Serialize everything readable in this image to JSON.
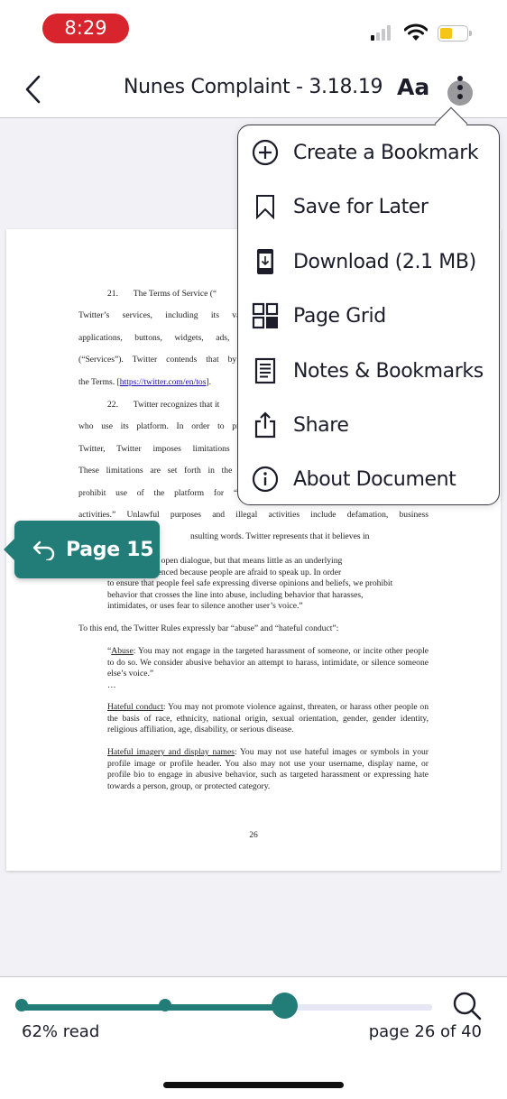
{
  "status_bar": {
    "time": "8:29",
    "signal_bars_active": 1,
    "signal_bars_total": 4,
    "battery_level": 0.45,
    "battery_color": "#f5c518",
    "time_pill_color": "#d7242d"
  },
  "header": {
    "back_icon": "chevron-left-icon",
    "title": "Nunes Complaint - 3.18.19",
    "text_size_label": "Aa",
    "more_icon": "more-vertical-icon"
  },
  "menu": {
    "items": [
      {
        "icon": "plus-circle-icon",
        "label": "Create a Bookmark"
      },
      {
        "icon": "bookmark-icon",
        "label": "Save for Later"
      },
      {
        "icon": "download-device-icon",
        "label": "Download (2.1 MB)"
      },
      {
        "icon": "grid-icon",
        "label": "Page Grid"
      },
      {
        "icon": "notes-icon",
        "label": "Notes & Bookmarks"
      },
      {
        "icon": "share-icon",
        "label": "Share"
      },
      {
        "icon": "info-icon",
        "label": "About Document"
      }
    ]
  },
  "document": {
    "paragraph_21": {
      "number": "21.",
      "lines": [
        "The Terms of Service (“",
        "Twitter’s services, including its vario",
        "applications, buttons, widgets, ads, co",
        "(“Services”). Twitter contends that by u",
        "the Terms. [",
        "https://twitter.com/en/tos",
        "]."
      ]
    },
    "paragraph_22": {
      "number": "22.",
      "lines": [
        "Twitter recognizes that it",
        "who use its platform. In order to prote",
        "Twitter, Twitter imposes limitations on",
        "These limitations are set forth in the Tw",
        "prohibit use of the platform for “any",
        "activities.”  Unlawful purposes and illegal activities include defamation, business",
        "nsulting words.  Twitter represents that it believes in"
      ]
    },
    "quote_block": "expression and open dialogue, but that means little as an underlying\nf voices are silenced because people are afraid to speak up.  In order\nto ensure that people feel safe expressing diverse opinions and beliefs, we prohibit\nbehavior that crosses the line into abuse, including behavior that harasses,\nintimidates, or uses fear to silence another user’s voice.”",
    "rules_intro": "To this end, the Twitter Rules expressly bar “abuse” and “hateful conduct”:",
    "abuse": {
      "open_quote": "“",
      "heading": "Abuse",
      "text": ":          You may not engage in the targeted harassment of someone, or incite other people to do so.  We consider abusive behavior an attempt to harass, intimidate, or silence someone else’s voice.”"
    },
    "ellipsis": "…",
    "hateful_conduct": {
      "heading": "Hateful conduct",
      "text": ":          You may not promote violence against, threaten, or harass other people on the basis of race, ethnicity, national origin, sexual orientation, gender, gender identity, religious affiliation, age, disability, or serious disease."
    },
    "hateful_imagery": {
      "heading": "Hateful imagery and display names",
      "text": ":  You may not use hateful images or symbols in your profile image or profile header.  You also may not use your username, display name, or profile bio to engage in abusive behavior, such as targeted harassment or expressing hate towards a person, group, or protected category."
    },
    "page_number": "26"
  },
  "return_bubble": {
    "icon": "return-arrow-icon",
    "label": "Page 15",
    "color": "#227d78"
  },
  "progress": {
    "percent_read": 62,
    "read_label": "62% read",
    "page_label": "page 26 of 40",
    "current_page": 26,
    "total_pages": 40,
    "marker_fractions": [
      0,
      0.35
    ],
    "thumb_fraction": 0.64,
    "accent_color": "#227d78",
    "search_icon": "search-icon"
  }
}
